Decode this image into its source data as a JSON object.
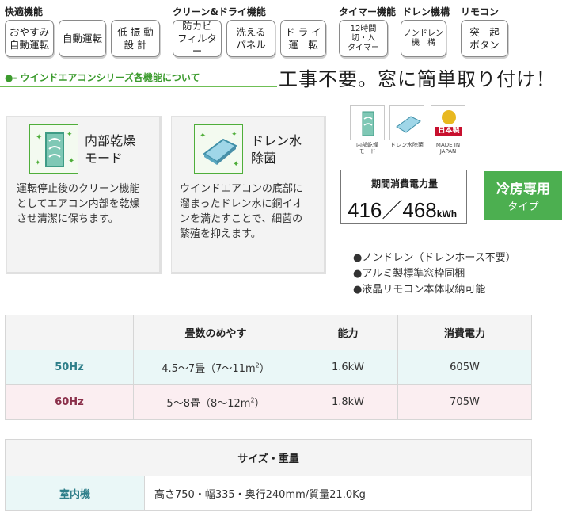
{
  "feature_groups": [
    {
      "title": "快適機能",
      "buttons": [
        "おやすみ\n自動運転",
        "自動運転",
        "低 振 動\n設 計"
      ]
    },
    {
      "title": "クリーン&ドライ機能",
      "buttons": [
        "防カビ\nフィルター",
        "洗える\nパネル",
        "ド ラ イ\n運　転"
      ]
    },
    {
      "title": "タイマー機能",
      "buttons": [
        "12時間\n切・入\nタイマー"
      ]
    },
    {
      "title": "ドレン機構",
      "buttons": [
        "ノンドレン\n機　構"
      ]
    },
    {
      "title": "リモコン",
      "buttons": [
        "突　起\nボタン"
      ]
    }
  ],
  "section": {
    "heading": "ウインドエアコンシリーズ各機能について",
    "tagline": "工事不要。窓に簡単取り付け！"
  },
  "cards": [
    {
      "icon": "sparkle-panel-icon",
      "title": "内部乾燥\nモード",
      "body": "運転停止後のクリーン機能\nとしてエアコン内部を乾燥\nさせ清潔に保ちます。"
    },
    {
      "icon": "sparkle-tray-icon",
      "title": "ドレン水\n除菌",
      "body": "ウインドエアコンの底部に\n溜まったドレン水に銅イオ\nンを満たすことで、細菌の\n繁殖を抑えます。"
    }
  ],
  "mini_icons": [
    {
      "name": "dry-mode-icon",
      "label": "内部乾燥\nモード"
    },
    {
      "name": "drain-sterilize-icon",
      "label": "ドレン水除菌"
    },
    {
      "name": "made-in-japan-icon",
      "label": "日本製",
      "sublabel": "MADE IN JAPAN"
    }
  ],
  "power": {
    "title": "期間消費電力量",
    "value": "416／468",
    "unit": "kWh"
  },
  "cooling_badge": {
    "line1": "冷房専用",
    "line2": "タイプ"
  },
  "bullets": [
    "●ノンドレン（ドレンホース不要）",
    "●アルミ製標準窓枠同梱",
    "●液晶リモコン本体収納可能"
  ],
  "spec_table": {
    "headers": [
      "",
      "畳数のめやす",
      "能力",
      "消費電力"
    ],
    "rows": [
      {
        "hz": "50Hz",
        "area": "4.5〜7畳（7〜11m",
        "area_unit": "2",
        "area_tail": "）",
        "capacity": "1.6kW",
        "power": "605W"
      },
      {
        "hz": "60Hz",
        "area": "5〜8畳（8〜12m",
        "area_unit": "2",
        "area_tail": "）",
        "capacity": "1.8kW",
        "power": "705W"
      }
    ]
  },
  "size_table": {
    "header": "サイズ・重量",
    "label": "室内機",
    "value": "高さ750・幅335・奥行240mm/質量21.0Kg"
  },
  "colors": {
    "accent_green": "#4caf50",
    "hz50": "#2f7f8a",
    "hz60": "#8a2f4a"
  }
}
